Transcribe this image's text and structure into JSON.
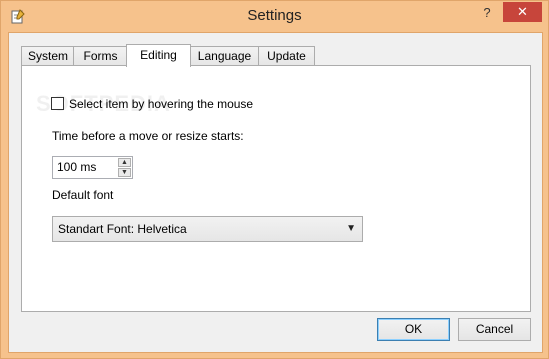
{
  "window": {
    "title": "Settings",
    "help_label": "?",
    "close_label": "✕"
  },
  "tabs": [
    {
      "label": "System",
      "active": false
    },
    {
      "label": "Forms",
      "active": false
    },
    {
      "label": "Editing",
      "active": true
    },
    {
      "label": "Language",
      "active": false
    },
    {
      "label": "Update",
      "active": false
    }
  ],
  "editing": {
    "hover_select": {
      "label": "Select item by hovering the mouse",
      "checked": false
    },
    "move_delay_label": "Time before a move or resize starts:",
    "move_delay_value": "100 ms",
    "default_font_label": "Default font",
    "default_font_value": "Standart Font: Helvetica"
  },
  "footer": {
    "ok_label": "OK",
    "cancel_label": "Cancel"
  },
  "watermark": "SOFTPEDIA"
}
